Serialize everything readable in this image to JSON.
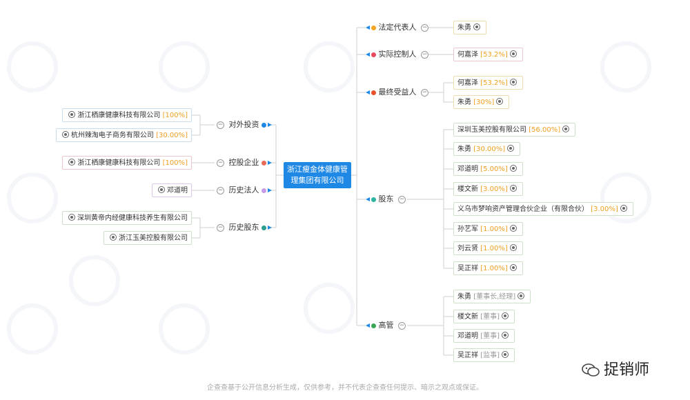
{
  "company": {
    "name": "浙江瘦金体健康管理集团有限公司"
  },
  "categories": {
    "legal_rep": "法定代表人",
    "actual_controller": "实际控制人",
    "beneficiary": "最终受益人",
    "shareholders": "股东",
    "executives": "高管",
    "investments": "对外投资",
    "holding": "控股企业",
    "history_legal": "历史法人",
    "history_shareholders": "历史股东"
  },
  "legal_rep_items": [
    {
      "name": "朱勇"
    }
  ],
  "actual_controller_items": [
    {
      "name": "何嘉泽",
      "pct": "[53.2%]"
    }
  ],
  "beneficiary_items": [
    {
      "name": "何嘉泽",
      "pct": "[53.2%]"
    },
    {
      "name": "朱勇",
      "pct": "[30%]"
    }
  ],
  "shareholder_items": [
    {
      "name": "深圳玉美控股有限公司",
      "pct": "[56.00%]"
    },
    {
      "name": "朱勇",
      "pct": "[30.00%]"
    },
    {
      "name": "邓道明",
      "pct": "[5.00%]"
    },
    {
      "name": "楼文新",
      "pct": "[3.00%]"
    },
    {
      "name": "义乌市梦响资产管理合伙企业（有限合伙）",
      "pct": "[3.00%]"
    },
    {
      "name": "孙艺军",
      "pct": "[1.00%]"
    },
    {
      "name": "刘云贤",
      "pct": "[1.00%]"
    },
    {
      "name": "吴正祥",
      "pct": "[1.00%]"
    }
  ],
  "executive_items": [
    {
      "name": "朱勇",
      "role": "[董事长,经理]"
    },
    {
      "name": "楼文新",
      "role": "[董事]"
    },
    {
      "name": "邓道明",
      "role": "[董事]"
    },
    {
      "name": "吴正祥",
      "role": "[监事]"
    }
  ],
  "investment_items": [
    {
      "name": "浙江栖康健康科技有限公司",
      "pct": "[100%]"
    },
    {
      "name": "杭州辣淘电子商务有限公司",
      "pct": "[30.00%]"
    }
  ],
  "holding_items": [
    {
      "name": "浙江栖康健康科技有限公司",
      "pct": "[100%]"
    }
  ],
  "history_legal_items": [
    {
      "name": "邓道明"
    }
  ],
  "history_shareholder_items": [
    {
      "name": "深圳黄帝内经健康科技养生有限公司"
    },
    {
      "name": "浙江玉美控股有限公司"
    }
  ],
  "colors": {
    "center": "#1f88e5",
    "legal_rep_dot": "#f5a623",
    "actual_controller_dot": "#e84a5f",
    "beneficiary_dot": "#e8502a",
    "shareholders_dot": "#2bb5a0",
    "executives_dot": "#3aa655",
    "investments_dot": "#1f88e5",
    "holding_dot": "#e86a5a",
    "history_legal_dot": "#c79be8",
    "history_shareholders_dot": "#2a9d8f"
  },
  "footer": "企查查基于公开信息分析生成，仅供参考，并不代表企查查任何提示、暗示之观点或保证。",
  "brand": "捉销师"
}
